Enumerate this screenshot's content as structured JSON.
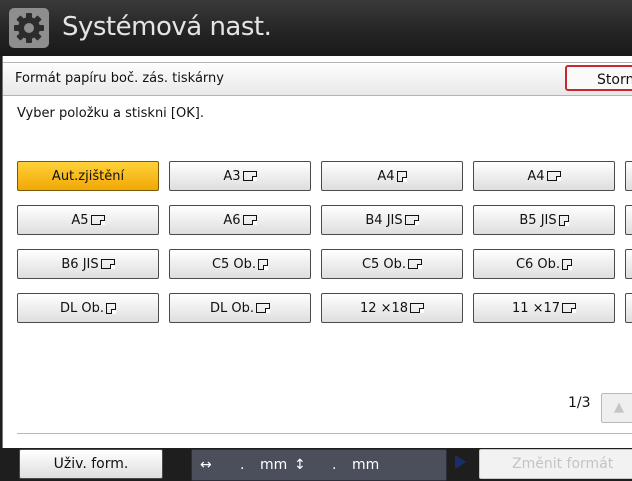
{
  "header": {
    "title": "Systémová nast."
  },
  "dialog": {
    "title": "Formát papíru boč. zás. tiskárny",
    "cancel_label": "Storno",
    "instruction": "Vyber položku a stiskni [OK]."
  },
  "sizes": [
    {
      "label": "Aut.zjištění",
      "orient": "",
      "selected": true
    },
    {
      "label": "A3",
      "orient": "land"
    },
    {
      "label": "A4",
      "orient": "port"
    },
    {
      "label": "A4",
      "orient": "land"
    },
    {
      "label": "A5",
      "orient": "land"
    },
    {
      "label": "A6",
      "orient": "land"
    },
    {
      "label": "B4 JIS",
      "orient": "land"
    },
    {
      "label": "B5 JIS",
      "orient": "port"
    },
    {
      "label": "B6 JIS",
      "orient": "land"
    },
    {
      "label": "C5 Ob.",
      "orient": "port"
    },
    {
      "label": "C5 Ob.",
      "orient": "land"
    },
    {
      "label": "C6 Ob.",
      "orient": "port"
    },
    {
      "label": "DL Ob.",
      "orient": "port"
    },
    {
      "label": "DL Ob.",
      "orient": "land"
    },
    {
      "label": "12 ×18",
      "orient": "land"
    },
    {
      "label": "11 ×17",
      "orient": "land"
    }
  ],
  "pager": {
    "text": "1/3",
    "up_icon": "▲"
  },
  "custom_size_label": "Uživ. form.",
  "dims": {
    "h_icon": "↔",
    "h_value": ".",
    "unit1": "mm",
    "v_icon": "↕",
    "v_value": ".",
    "unit2": "mm"
  },
  "change_size_label": "Změnit formát"
}
